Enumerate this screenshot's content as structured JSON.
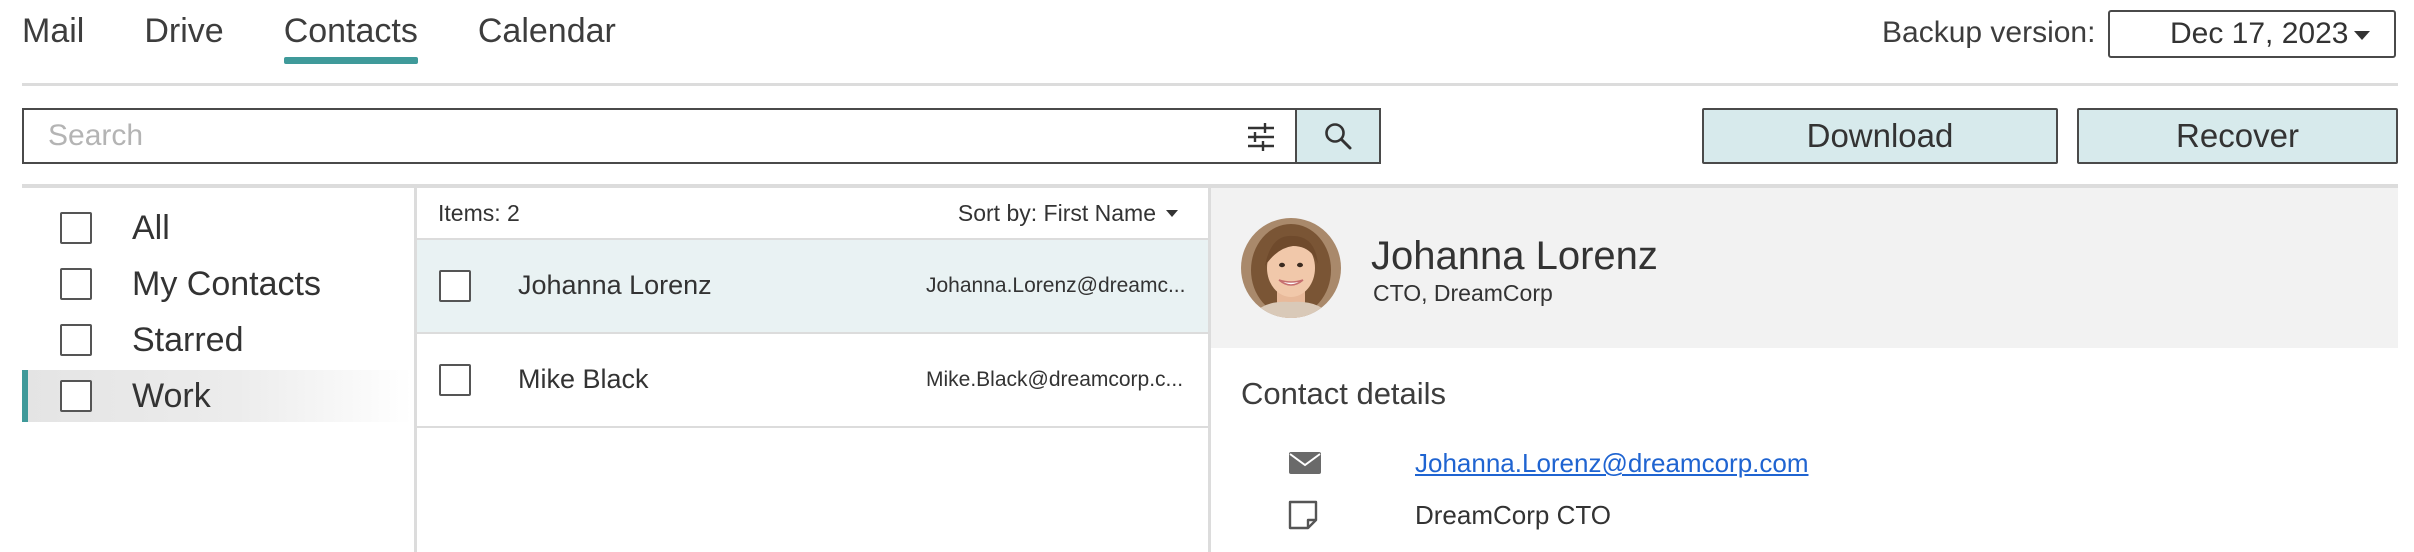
{
  "nav": {
    "tabs": [
      {
        "label": "Mail"
      },
      {
        "label": "Drive"
      },
      {
        "label": "Contacts"
      },
      {
        "label": "Calendar"
      }
    ],
    "active_tab": "Contacts"
  },
  "backup": {
    "label": "Backup version:",
    "selected": "Dec 17, 2023"
  },
  "toolbar": {
    "search_placeholder": "Search",
    "download_label": "Download",
    "recover_label": "Recover"
  },
  "folders": [
    {
      "label": "All",
      "selected": false
    },
    {
      "label": "My Contacts",
      "selected": false
    },
    {
      "label": "Starred",
      "selected": false
    },
    {
      "label": "Work",
      "selected": true
    }
  ],
  "list": {
    "items_count": "Items: 2",
    "sort_label": "Sort by: First Name",
    "rows": [
      {
        "name": "Johanna Lorenz",
        "email": "Johanna.Lorenz@dreamc...",
        "selected": true
      },
      {
        "name": "Mike Black",
        "email": "Mike.Black@dreamcorp.c...",
        "selected": false
      }
    ]
  },
  "detail": {
    "name": "Johanna Lorenz",
    "title": "CTO, DreamCorp",
    "section_title": "Contact details",
    "email": "Johanna.Lorenz@dreamcorp.com",
    "note": "DreamCorp CTO"
  },
  "colors": {
    "accent": "#3f9a9a",
    "button_bg": "#d7eaec",
    "link": "#1f64d1"
  },
  "icons": [
    "filter-sliders-icon",
    "search-icon",
    "caret-down-icon",
    "envelope-icon",
    "note-icon",
    "avatar-photo"
  ]
}
